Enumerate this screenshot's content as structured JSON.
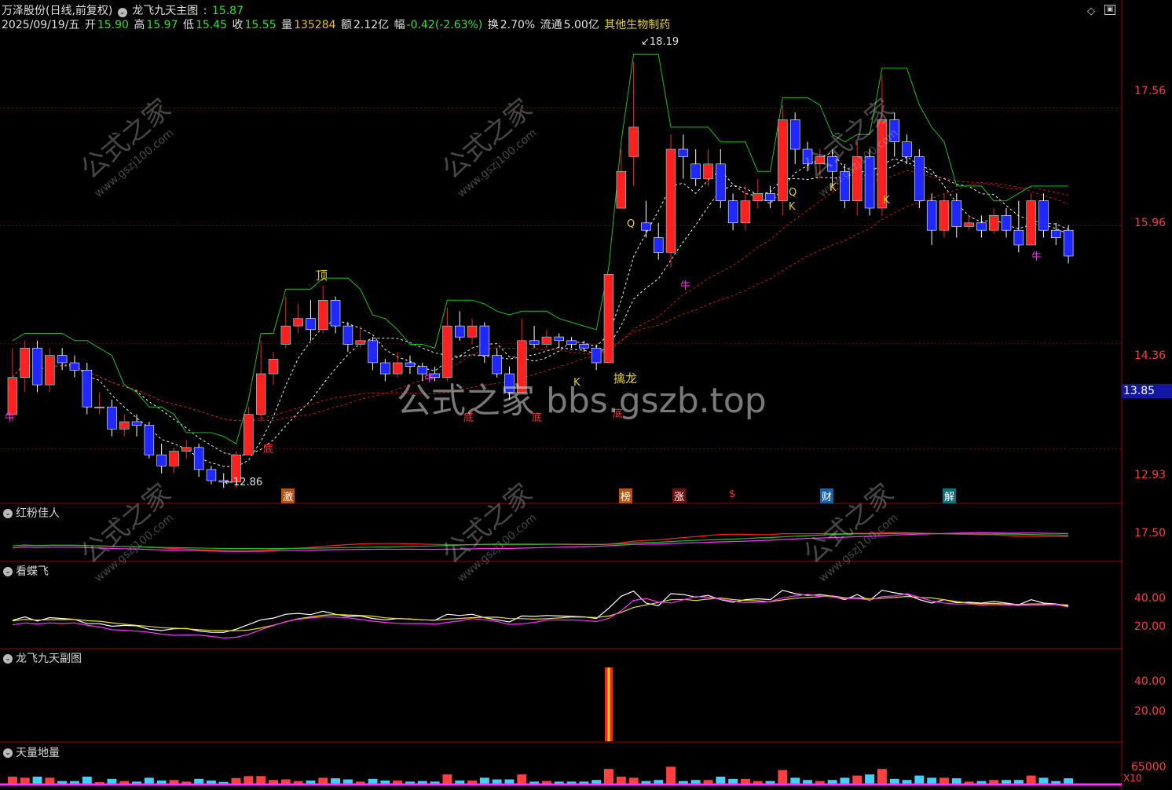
{
  "header": {
    "stock_name": "万泽股份(日线,前复权)",
    "indicator_name": "龙飞九天主图",
    "indicator_value": "15.87",
    "date": "2025/09/19/五",
    "open_label": "开",
    "open": "15.90",
    "high_label": "高",
    "high": "15.97",
    "low_label": "低",
    "low": "15.45",
    "close_label": "收",
    "close": "15.55",
    "volume_label": "量",
    "volume": "135284",
    "amount_label": "额",
    "amount": "2.12亿",
    "change_label": "幅",
    "change": "-0.42(-2.63%)",
    "turnover_label": "换",
    "turnover": "2.70%",
    "float_label": "流通",
    "float": "5.00亿",
    "sector": "其他生物制药"
  },
  "colors": {
    "up": "#ff2020",
    "down": "#1e28ff",
    "up_cyan": "#40ffff",
    "green_line": "#18c018",
    "magenta_line": "#ff30ff",
    "white_dash": "#f0f0f0",
    "red_dash": "#c81818",
    "axis_text": "#ff3c3c",
    "panel_border": "#a00000",
    "current_price_box": "#1418a0"
  },
  "main_axis": {
    "ticks": [
      "17.56",
      "15.96",
      "14.36",
      "12.93"
    ],
    "current_price": "13.85"
  },
  "annotations": {
    "high_mark": "18.19",
    "low_mark": "12.86",
    "top_label": "顶",
    "bottom_label": "底",
    "bull_label": "牛",
    "dragon_label": "擒龙",
    "k_label": "K",
    "q_label": "Q"
  },
  "event_tags": [
    "激",
    "榜",
    "涨",
    "$",
    "财",
    "解"
  ],
  "watermark": {
    "text_cn": "公式之家",
    "text_url": "www.gszj100.com",
    "center_text": "公式之家 bbs.gszb.top"
  },
  "panels": [
    {
      "title": "红粉佳人",
      "axis": [
        "17.50"
      ]
    },
    {
      "title": "看蝶飞",
      "axis": [
        "40.00",
        "20.00"
      ]
    },
    {
      "title": "龙飞九天副图",
      "axis": [
        "40.00",
        "20.00"
      ]
    },
    {
      "title": "天量地量",
      "axis": [
        "65000"
      ],
      "footer": "X10"
    }
  ],
  "chart_data": {
    "type": "candlestick",
    "title": "龙飞九天主图",
    "ylim": [
      12.5,
      18.6
    ],
    "candles": [
      {
        "o": 13.4,
        "c": 13.9,
        "h": 14.3,
        "l": 13.3
      },
      {
        "o": 13.9,
        "c": 14.3,
        "h": 14.4,
        "l": 13.7
      },
      {
        "o": 14.3,
        "c": 13.8,
        "h": 14.4,
        "l": 13.7
      },
      {
        "o": 13.8,
        "c": 14.2,
        "h": 14.3,
        "l": 13.7
      },
      {
        "o": 14.2,
        "c": 14.1,
        "h": 14.3,
        "l": 14.0
      },
      {
        "o": 14.1,
        "c": 14.0,
        "h": 14.2,
        "l": 13.9
      },
      {
        "o": 14.0,
        "c": 13.5,
        "h": 14.1,
        "l": 13.4
      },
      {
        "o": 13.5,
        "c": 13.5,
        "h": 13.7,
        "l": 13.4
      },
      {
        "o": 13.5,
        "c": 13.2,
        "h": 13.6,
        "l": 13.1
      },
      {
        "o": 13.2,
        "c": 13.3,
        "h": 13.4,
        "l": 13.1
      },
      {
        "o": 13.3,
        "c": 13.25,
        "h": 13.4,
        "l": 13.1
      },
      {
        "o": 13.25,
        "c": 12.85,
        "h": 13.3,
        "l": 12.8
      },
      {
        "o": 12.85,
        "c": 12.7,
        "h": 13.0,
        "l": 12.6
      },
      {
        "o": 12.7,
        "c": 12.9,
        "h": 12.95,
        "l": 12.6
      },
      {
        "o": 12.9,
        "c": 12.95,
        "h": 13.05,
        "l": 12.8
      },
      {
        "o": 12.95,
        "c": 12.65,
        "h": 13.0,
        "l": 12.55
      },
      {
        "o": 12.65,
        "c": 12.5,
        "h": 12.7,
        "l": 12.45
      },
      {
        "o": 12.5,
        "c": 12.48,
        "h": 12.6,
        "l": 12.4
      },
      {
        "o": 12.48,
        "c": 12.85,
        "h": 12.9,
        "l": 12.4
      },
      {
        "o": 12.85,
        "c": 13.4,
        "h": 13.5,
        "l": 12.85
      },
      {
        "o": 13.4,
        "c": 13.95,
        "h": 14.4,
        "l": 13.3
      },
      {
        "o": 13.95,
        "c": 14.15,
        "h": 14.25,
        "l": 13.8
      },
      {
        "o": 14.35,
        "c": 14.6,
        "h": 15.0,
        "l": 14.3
      },
      {
        "o": 14.6,
        "c": 14.7,
        "h": 14.9,
        "l": 14.5
      },
      {
        "o": 14.7,
        "c": 14.55,
        "h": 14.95,
        "l": 14.4
      },
      {
        "o": 14.55,
        "c": 14.95,
        "h": 15.15,
        "l": 14.5
      },
      {
        "o": 14.95,
        "c": 14.6,
        "h": 15.0,
        "l": 14.5
      },
      {
        "o": 14.6,
        "c": 14.35,
        "h": 14.65,
        "l": 14.25
      },
      {
        "o": 14.35,
        "c": 14.4,
        "h": 14.6,
        "l": 14.3
      },
      {
        "o": 14.4,
        "c": 14.1,
        "h": 14.45,
        "l": 14.0
      },
      {
        "o": 14.1,
        "c": 13.95,
        "h": 14.15,
        "l": 13.85
      },
      {
        "o": 13.95,
        "c": 14.1,
        "h": 14.25,
        "l": 13.9
      },
      {
        "o": 14.1,
        "c": 14.05,
        "h": 14.2,
        "l": 13.95
      },
      {
        "o": 14.05,
        "c": 13.95,
        "h": 14.1,
        "l": 13.85
      },
      {
        "o": 13.95,
        "c": 13.9,
        "h": 14.05,
        "l": 13.85
      },
      {
        "o": 13.9,
        "c": 14.6,
        "h": 14.85,
        "l": 13.85
      },
      {
        "o": 14.6,
        "c": 14.45,
        "h": 14.8,
        "l": 14.4
      },
      {
        "o": 14.45,
        "c": 14.6,
        "h": 14.7,
        "l": 14.35
      },
      {
        "o": 14.6,
        "c": 14.2,
        "h": 14.65,
        "l": 14.1
      },
      {
        "o": 14.2,
        "c": 13.95,
        "h": 14.3,
        "l": 13.9
      },
      {
        "o": 13.95,
        "c": 13.7,
        "h": 14.05,
        "l": 13.6
      },
      {
        "o": 13.7,
        "c": 14.4,
        "h": 14.7,
        "l": 13.7
      },
      {
        "o": 14.4,
        "c": 14.35,
        "h": 14.6,
        "l": 14.3
      },
      {
        "o": 14.35,
        "c": 14.45,
        "h": 14.55,
        "l": 14.3
      },
      {
        "o": 14.45,
        "c": 14.4,
        "h": 14.5,
        "l": 14.3
      },
      {
        "o": 14.4,
        "c": 14.35,
        "h": 14.45,
        "l": 14.3
      },
      {
        "o": 14.35,
        "c": 14.3,
        "h": 14.4,
        "l": 14.25
      },
      {
        "o": 14.3,
        "c": 14.1,
        "h": 14.35,
        "l": 14.0
      },
      {
        "o": 14.1,
        "c": 15.3,
        "h": 15.3,
        "l": 14.1
      },
      {
        "o": 16.2,
        "c": 16.7,
        "h": 17.0,
        "l": 16.2
      },
      {
        "o": 16.9,
        "c": 17.3,
        "h": 18.19,
        "l": 16.5
      },
      {
        "o": 16.0,
        "c": 15.9,
        "h": 16.3,
        "l": 15.8
      },
      {
        "o": 15.8,
        "c": 15.6,
        "h": 16.0,
        "l": 15.5
      },
      {
        "o": 15.6,
        "c": 17.0,
        "h": 17.2,
        "l": 15.4
      },
      {
        "o": 17.0,
        "c": 16.9,
        "h": 17.2,
        "l": 16.6
      },
      {
        "o": 16.8,
        "c": 16.6,
        "h": 17.0,
        "l": 16.5
      },
      {
        "o": 16.6,
        "c": 16.8,
        "h": 17.0,
        "l": 16.5
      },
      {
        "o": 16.8,
        "c": 16.3,
        "h": 17.0,
        "l": 16.2
      },
      {
        "o": 16.3,
        "c": 16.0,
        "h": 16.4,
        "l": 15.9
      },
      {
        "o": 16.0,
        "c": 16.3,
        "h": 16.5,
        "l": 15.9
      },
      {
        "o": 16.3,
        "c": 16.4,
        "h": 16.6,
        "l": 16.2
      },
      {
        "o": 16.4,
        "c": 16.3,
        "h": 16.5,
        "l": 16.2
      },
      {
        "o": 16.3,
        "c": 17.4,
        "h": 17.6,
        "l": 16.1
      },
      {
        "o": 17.4,
        "c": 17.0,
        "h": 17.5,
        "l": 16.8
      },
      {
        "o": 17.0,
        "c": 16.8,
        "h": 17.1,
        "l": 16.7
      },
      {
        "o": 16.8,
        "c": 16.9,
        "h": 17.0,
        "l": 16.6
      },
      {
        "o": 16.9,
        "c": 16.7,
        "h": 17.0,
        "l": 16.5
      },
      {
        "o": 16.7,
        "c": 16.3,
        "h": 16.8,
        "l": 16.2
      },
      {
        "o": 16.3,
        "c": 16.9,
        "h": 17.1,
        "l": 16.1
      },
      {
        "o": 16.9,
        "c": 16.2,
        "h": 17.0,
        "l": 16.1
      },
      {
        "o": 16.2,
        "c": 17.4,
        "h": 18.0,
        "l": 16.1
      },
      {
        "o": 17.4,
        "c": 17.1,
        "h": 17.5,
        "l": 16.9
      },
      {
        "o": 17.1,
        "c": 16.9,
        "h": 17.2,
        "l": 16.8
      },
      {
        "o": 16.9,
        "c": 16.3,
        "h": 17.0,
        "l": 16.2
      },
      {
        "o": 16.3,
        "c": 15.9,
        "h": 16.4,
        "l": 15.7
      },
      {
        "o": 15.9,
        "c": 16.3,
        "h": 16.4,
        "l": 15.8
      },
      {
        "o": 16.3,
        "c": 15.95,
        "h": 16.4,
        "l": 15.8
      },
      {
        "o": 15.95,
        "c": 16.0,
        "h": 16.1,
        "l": 15.9
      },
      {
        "o": 16.0,
        "c": 15.9,
        "h": 16.1,
        "l": 15.8
      },
      {
        "o": 15.9,
        "c": 16.1,
        "h": 16.2,
        "l": 15.85
      },
      {
        "o": 16.1,
        "c": 15.9,
        "h": 16.2,
        "l": 15.8
      },
      {
        "o": 15.9,
        "c": 15.7,
        "h": 16.3,
        "l": 15.6
      },
      {
        "o": 15.7,
        "c": 16.3,
        "h": 16.4,
        "l": 15.7
      },
      {
        "o": 16.3,
        "c": 15.9,
        "h": 16.4,
        "l": 15.8
      },
      {
        "o": 15.9,
        "c": 15.8,
        "h": 16.0,
        "l": 15.7
      },
      {
        "o": 15.9,
        "c": 15.55,
        "h": 15.97,
        "l": 15.45
      }
    ]
  }
}
